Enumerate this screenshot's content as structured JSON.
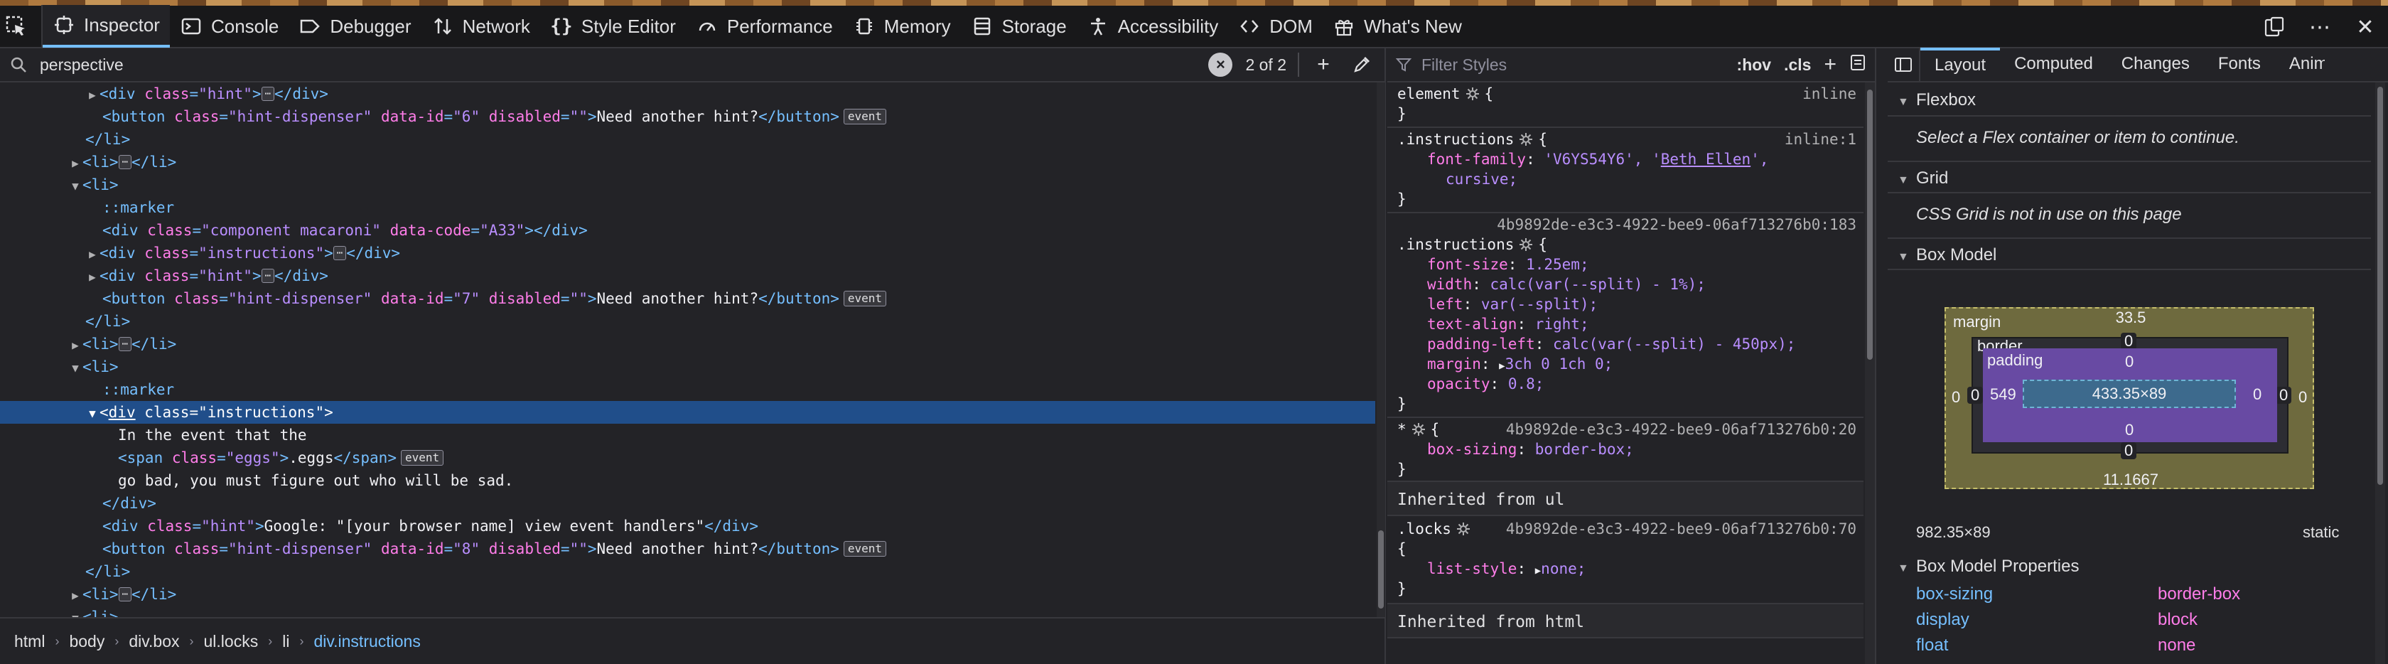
{
  "toolbar": {
    "tabs": [
      {
        "label": "Inspector",
        "icon": "inspector-icon"
      },
      {
        "label": "Console",
        "icon": "console-icon"
      },
      {
        "label": "Debugger",
        "icon": "debugger-icon"
      },
      {
        "label": "Network",
        "icon": "network-icon"
      },
      {
        "label": "Style Editor",
        "icon": "style-editor-icon"
      },
      {
        "label": "Performance",
        "icon": "performance-icon"
      },
      {
        "label": "Memory",
        "icon": "memory-icon"
      },
      {
        "label": "Storage",
        "icon": "storage-icon"
      },
      {
        "label": "Accessibility",
        "icon": "accessibility-icon"
      },
      {
        "label": "DOM",
        "icon": "dom-icon"
      },
      {
        "label": "What's New",
        "icon": "gift-icon"
      }
    ]
  },
  "search": {
    "value": "perspective",
    "count": "2 of 2"
  },
  "markup": {
    "lines": [
      {
        "t": "<div class=\"hint\">",
        "e": "</div>"
      },
      {
        "t": "<button class=\"hint-dispenser\" data-id=\"6\" disabled=\"\">Need another hint?</button>",
        "badge": "event"
      },
      {
        "t": "</li>"
      },
      {
        "t": "<li>",
        "e": "</li>"
      },
      {
        "t": "<li>"
      },
      {
        "t": "::marker"
      },
      {
        "t": "<div class=\"component macaroni\" data-code=\"A33\"></div>"
      },
      {
        "t": "<div class=\"instructions\">",
        "e": "</div>"
      },
      {
        "t": "<div class=\"hint\">",
        "e": "</div>"
      },
      {
        "t": "<button class=\"hint-dispenser\" data-id=\"7\" disabled=\"\">Need another hint?</button>",
        "badge": "event"
      },
      {
        "t": "</li>"
      },
      {
        "t": "<li>",
        "e": "</li>"
      },
      {
        "t": "<li>"
      },
      {
        "t": "::marker"
      },
      {
        "t": "<div class=\"instructions\">"
      },
      {
        "t": "In the event that the"
      },
      {
        "t": "<span class=\"eggs\">.eggs</span>",
        "badge": "event"
      },
      {
        "t": "go bad, you must figure out who will be sad."
      },
      {
        "t": "</div>"
      },
      {
        "t": "<div class=\"hint\">Google: \"[your browser name] view event handlers\"</div>"
      },
      {
        "t": "<button class=\"hint-dispenser\" data-id=\"8\" disabled=\"\">Need another hint?</button>",
        "badge": "event"
      },
      {
        "t": "</li>"
      },
      {
        "t": "<li>",
        "e": "</li>"
      },
      {
        "t": "<li>"
      }
    ]
  },
  "breadcrumbs": [
    "html",
    "body",
    "div.box",
    "ul.locks",
    "li",
    "div.instructions"
  ],
  "rules": {
    "filter_placeholder": "Filter Styles",
    "hov": ":hov",
    "cls": ".cls",
    "element_selector": "element",
    "element_source": "inline",
    "r1_selector": ".instructions",
    "r1_source": "inline:1",
    "r1_prop": "font-family",
    "r1_val_a": "'V6YS54Y6', '",
    "r1_val_link": "Beth Ellen",
    "r1_val_b": "',",
    "r1_val_c": "cursive;",
    "r2_source": "4b9892de-e3c3-4922-bee9-06af713276b0:183",
    "r2_selector": ".instructions",
    "r2_props": [
      {
        "p": "font-size",
        "v": "1.25em;"
      },
      {
        "p": "width",
        "v": "calc(var(--split) - 1%);"
      },
      {
        "p": "left",
        "v": "var(--split);"
      },
      {
        "p": "text-align",
        "v": "right;"
      },
      {
        "p": "padding-left",
        "v": "calc(var(--split) - 450px);"
      },
      {
        "p": "margin",
        "v": "3ch 0 1ch 0;"
      },
      {
        "p": "opacity",
        "v": "0.8;"
      }
    ],
    "r3_selector": "*",
    "r3_source": "4b9892de-e3c3-4922-bee9-06af713276b0:20",
    "r3_prop": "box-sizing",
    "r3_val": "border-box;",
    "inherited_ul": "Inherited from ul",
    "r4_selector": ".locks",
    "r4_source": "4b9892de-e3c3-4922-bee9-06af713276b0:70",
    "r4_prop": "list-style",
    "r4_val": "none;",
    "inherited_html": "Inherited from html"
  },
  "side": {
    "tabs": [
      "Layout",
      "Computed",
      "Changes",
      "Fonts",
      "Animations"
    ],
    "flexbox_title": "Flexbox",
    "flexbox_msg": "Select a Flex container or item to continue.",
    "grid_title": "Grid",
    "grid_msg": "CSS Grid is not in use on this page",
    "boxmodel_title": "Box Model",
    "bm": {
      "margin_label": "margin",
      "border_label": "border",
      "padding_label": "padding",
      "margin_top": "33.5",
      "margin_bottom": "11.1667",
      "margin_left": "0",
      "margin_right": "0",
      "border_top": "0",
      "border_bottom": "0",
      "border_left": "0",
      "border_right": "0",
      "padding_top": "0",
      "padding_bottom": "0",
      "padding_left": "549",
      "padding_right": "0",
      "content": "433.35×89"
    },
    "size": "982.35×89",
    "position": "static",
    "props_title": "Box Model Properties",
    "props": [
      {
        "n": "box-sizing",
        "v": "border-box"
      },
      {
        "n": "display",
        "v": "block"
      },
      {
        "n": "float",
        "v": "none"
      }
    ]
  },
  "colors": {
    "accent": "#75bfff",
    "selected_row": "#204e8a",
    "tag": "#75bfff",
    "attr": "#ff7de9",
    "value": "#b98eff"
  }
}
